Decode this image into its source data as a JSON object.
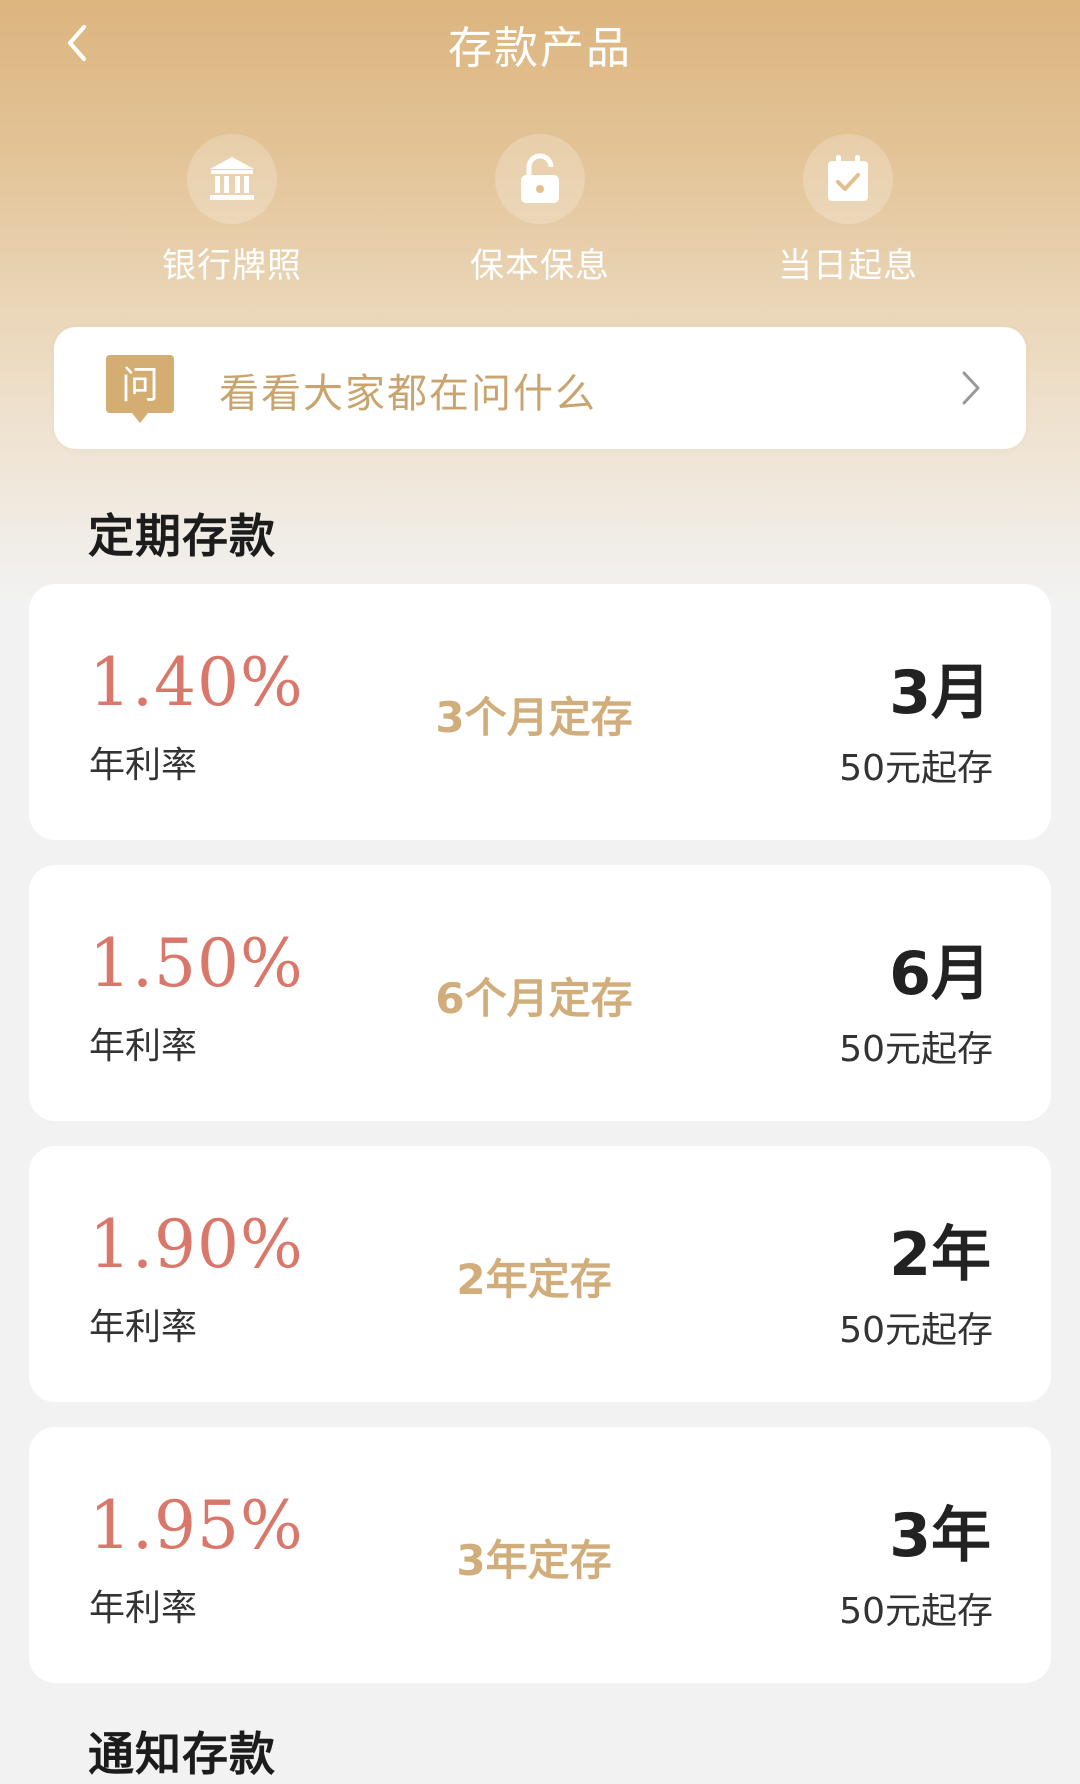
{
  "header": {
    "title": "存款产品"
  },
  "features": [
    {
      "label": "银行牌照",
      "icon": "bank-icon"
    },
    {
      "label": "保本保息",
      "icon": "lock-icon"
    },
    {
      "label": "当日起息",
      "icon": "calendar-check-icon"
    }
  ],
  "faq": {
    "icon_text": "问",
    "text": "看看大家都在问什么"
  },
  "sections": [
    {
      "title": "定期存款"
    },
    {
      "title": "通知存款"
    }
  ],
  "products": [
    {
      "rate": "1.40%",
      "rate_label": "年利率",
      "name": "3个月定存",
      "term": "3月",
      "min": "50元起存"
    },
    {
      "rate": "1.50%",
      "rate_label": "年利率",
      "name": "6个月定存",
      "term": "6月",
      "min": "50元起存"
    },
    {
      "rate": "1.90%",
      "rate_label": "年利率",
      "name": "2年定存",
      "term": "2年",
      "min": "50元起存"
    },
    {
      "rate": "1.95%",
      "rate_label": "年利率",
      "name": "3年定存",
      "term": "3年",
      "min": "50元起存"
    }
  ],
  "colors": {
    "header_gold": "#dcb57f",
    "rate_red": "#d9786a",
    "product_gold": "#d0ad7a",
    "faq_gold": "#c8a46e"
  }
}
